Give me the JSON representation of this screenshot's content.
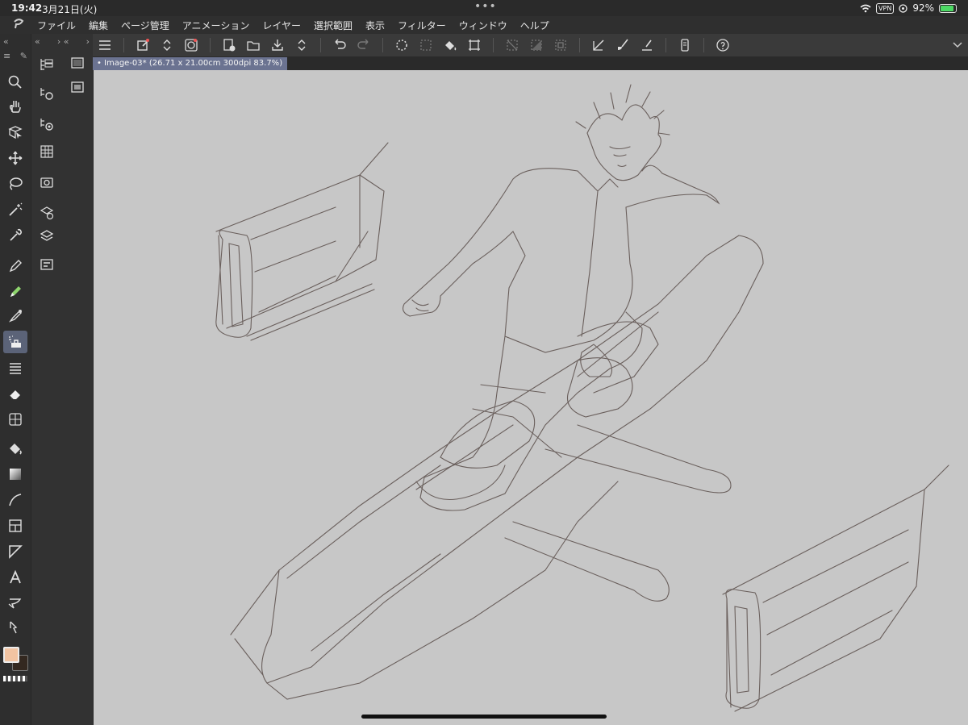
{
  "status_bar": {
    "time": "19:42",
    "date": "3月21日(火)",
    "vpn": "VPN",
    "battery": "92%"
  },
  "menu": {
    "items": [
      "ファイル",
      "編集",
      "ページ管理",
      "アニメーション",
      "レイヤー",
      "選択範囲",
      "表示",
      "フィルター",
      "ウィンドウ",
      "ヘルプ"
    ]
  },
  "document": {
    "tab_label": "Image-03* (26.71 x 21.00cm 300dpi 83.7%)"
  },
  "colors": {
    "main_color": "#f2c4a2",
    "sub_color": "#332820",
    "canvas_bg": "#c7c7c7",
    "active_tool_bg": "#5b6378",
    "tab_bg": "#6b7391"
  },
  "tools": [
    "zoom-icon",
    "hand-icon",
    "operation-icon",
    "move-icon",
    "lasso-icon",
    "magic-wand-icon",
    "eyedropper-icon",
    "pen-icon",
    "pencil-icon",
    "brush-icon",
    "airbrush-icon",
    "decoration-icon",
    "eraser-icon",
    "blend-icon",
    "fill-icon",
    "gradient-icon",
    "figure-icon",
    "frame-icon",
    "ruler-icon",
    "text-icon",
    "balloon-icon",
    "correct-line-icon"
  ],
  "toolbar_buttons": [
    "menu-icon",
    "edit-icon",
    "updown-icon",
    "spiral-icon",
    "new-page-icon",
    "open-icon",
    "save-icon",
    "updown-icon",
    "undo-icon",
    "redo-icon",
    "loading-icon",
    "selection-icon",
    "fill-icon",
    "transform-icon",
    "deselect-icon",
    "invert-icon",
    "border-icon",
    "ruler-icon",
    "brush-icon",
    "line-icon",
    "device-icon",
    "help-icon"
  ]
}
